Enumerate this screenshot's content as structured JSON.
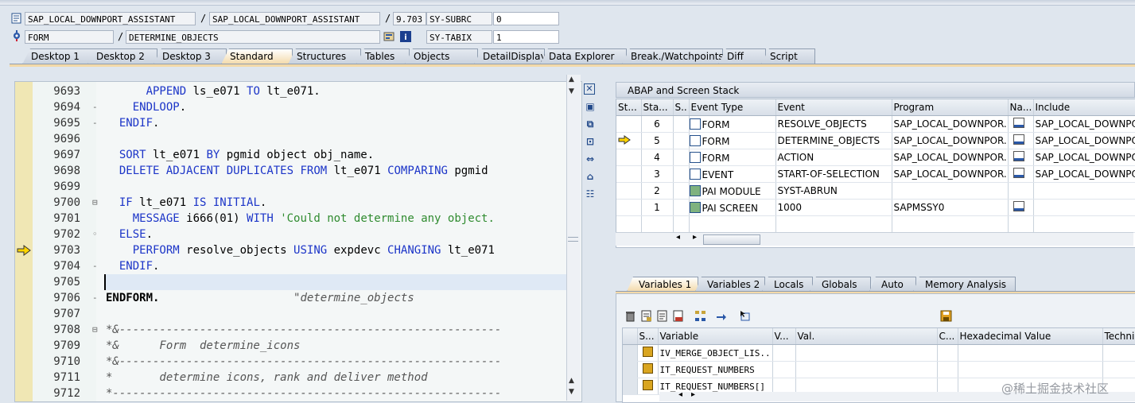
{
  "header": {
    "program": "SAP_LOCAL_DOWNPORT_ASSISTANT",
    "include": "SAP_LOCAL_DOWNPORT_ASSISTANT",
    "sep1": "/",
    "sep2": "/",
    "line_no": "9.703",
    "sysubrc_label": "SY-SUBRC",
    "sysubrc_value": "0",
    "event_type": "FORM",
    "event_name": "DETERMINE_OBJECTS",
    "sytabix_label": "SY-TABIX",
    "sytabix_value": "1"
  },
  "tabs": [
    "Desktop 1",
    "Desktop 2",
    "Desktop 3",
    "Standard",
    "Structures",
    "Tables",
    "Objects",
    "DetailDisplay",
    "Data Explorer",
    "Break./Watchpoints",
    "Diff",
    "Script"
  ],
  "active_tab": "Standard",
  "editor": {
    "lines": [
      {
        "n": "9693",
        "fold": "",
        "code": "      APPEND ls_e071 TO lt_e071."
      },
      {
        "n": "9694",
        "fold": "-",
        "code": "    ENDLOOP."
      },
      {
        "n": "9695",
        "fold": "-",
        "code": "  ENDIF."
      },
      {
        "n": "9696",
        "fold": "",
        "code": ""
      },
      {
        "n": "9697",
        "fold": "",
        "code": "  SORT lt_e071 BY pgmid object obj_name."
      },
      {
        "n": "9698",
        "fold": "",
        "code": "  DELETE ADJACENT DUPLICATES FROM lt_e071 COMPARING pgmid"
      },
      {
        "n": "9699",
        "fold": "",
        "code": ""
      },
      {
        "n": "9700",
        "fold": "⊟",
        "code": "  IF lt_e071 IS INITIAL."
      },
      {
        "n": "9701",
        "fold": "",
        "code": "    MESSAGE i666(01) WITH 'Could not determine any object."
      },
      {
        "n": "9702",
        "fold": "◦",
        "code": "  ELSE."
      },
      {
        "n": "9703",
        "fold": "",
        "code": "    PERFORM resolve_objects USING expdevc CHANGING lt_e071"
      },
      {
        "n": "9704",
        "fold": "-",
        "code": "  ENDIF."
      },
      {
        "n": "9705",
        "fold": "",
        "code": ""
      },
      {
        "n": "9706",
        "fold": "-",
        "code": "ENDFORM.                    \"determine_objects"
      },
      {
        "n": "9707",
        "fold": "",
        "code": ""
      },
      {
        "n": "9708",
        "fold": "⊟",
        "code": "*&---------------------------------------------------------"
      },
      {
        "n": "9709",
        "fold": "",
        "code": "*&      Form  determine_icons"
      },
      {
        "n": "9710",
        "fold": "",
        "code": "*&---------------------------------------------------------"
      },
      {
        "n": "9711",
        "fold": "",
        "code": "*       determine icons, rank and deliver method"
      },
      {
        "n": "9712",
        "fold": "",
        "code": "*----------------------------------------------------------"
      }
    ]
  },
  "stack": {
    "title": "ABAP and Screen Stack",
    "columns": [
      "St...",
      "Sta...",
      "S..",
      "Event Type",
      "Event",
      "Program",
      "Na...",
      "Include"
    ],
    "rows": [
      {
        "level": "6",
        "type": "FORM",
        "event": "RESOLVE_OBJECTS",
        "program": "SAP_LOCAL_DOWNPOR...",
        "include": "SAP_LOCAL_DOWNPOR",
        "current": false,
        "nav": true
      },
      {
        "level": "5",
        "type": "FORM",
        "event": "DETERMINE_OBJECTS",
        "program": "SAP_LOCAL_DOWNPOR...",
        "include": "SAP_LOCAL_DOWNPOR",
        "current": true,
        "nav": true
      },
      {
        "level": "4",
        "type": "FORM",
        "event": "ACTION",
        "program": "SAP_LOCAL_DOWNPOR...",
        "include": "SAP_LOCAL_DOWNPOR",
        "current": false,
        "nav": true
      },
      {
        "level": "3",
        "type": "EVENT",
        "event": "START-OF-SELECTION",
        "program": "SAP_LOCAL_DOWNPOR...",
        "include": "SAP_LOCAL_DOWNPOR",
        "current": false,
        "nav": true
      },
      {
        "level": "2",
        "type": "PAI MODULE",
        "event": "SYST-ABRUN",
        "program": "",
        "include": "",
        "current": false,
        "nav": false
      },
      {
        "level": "1",
        "type": "PAI SCREEN",
        "event": "1000",
        "program": "SAPMSSY0",
        "include": "",
        "current": false,
        "nav": true
      }
    ]
  },
  "var_tabs": [
    "Variables 1",
    "Variables 2",
    "Locals",
    "Globals",
    "Auto",
    "Memory Analysis"
  ],
  "active_var_tab": "Variables 1",
  "variables": {
    "columns": [
      "S...",
      "Variable",
      "V...",
      "Val.",
      "C...",
      "Hexadecimal Value",
      "Techni"
    ],
    "rows": [
      {
        "name": "IV_MERGE_OBJECT_LIS..."
      },
      {
        "name": "IT_REQUEST_NUMBERS"
      },
      {
        "name": "IT_REQUEST_NUMBERS[]"
      }
    ]
  },
  "watermark": "@稀土掘金技术社区",
  "colors": {
    "keyword": "#1c35c8",
    "string": "#2f8b2f",
    "active_tab": "#f3d9a8"
  }
}
